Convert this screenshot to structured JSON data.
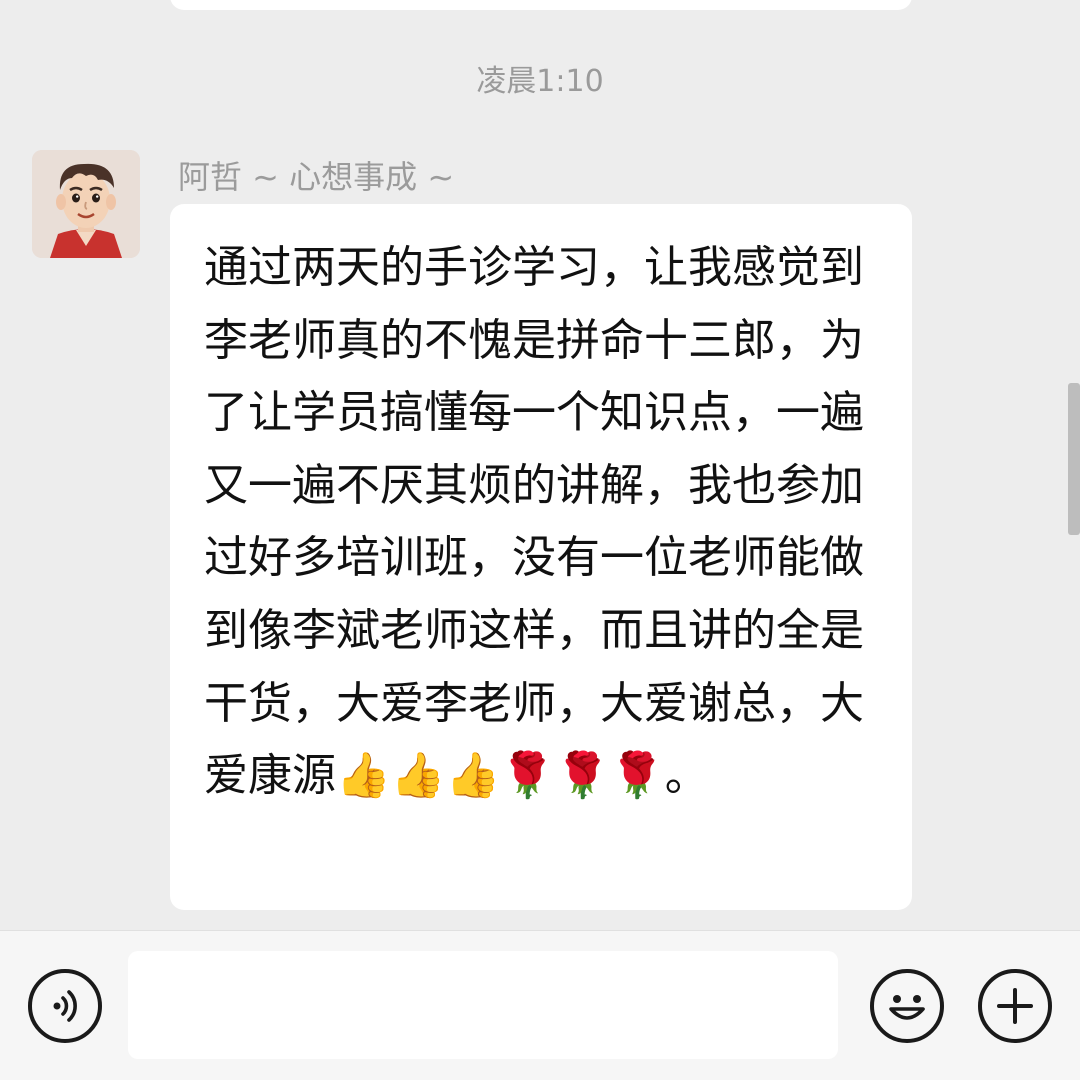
{
  "chat": {
    "timestamp": "凌晨1:10",
    "message": {
      "sender": "阿哲 ~ 心想事成 ~",
      "text": "通过两天的手诊学习，让我感觉到李老师真的不愧是拼命十三郎，为了让学员搞懂每一个知识点，一遍又一遍不厌其烦的讲解，我也参加过好多培训班，没有一位老师能做到像李斌老师这样，而且讲的全是干货，大爱李老师，大爱谢总，大爱康源👍👍👍🌹🌹🌹。"
    }
  },
  "input_bar": {
    "message_value": "",
    "icons": {
      "voice": "voice-icon",
      "emoji": "emoji-smile-icon",
      "add": "plus-icon"
    }
  },
  "colors": {
    "background": "#ededed",
    "bubble": "#ffffff",
    "timestamp": "#9a9a9a",
    "sender": "#9b9b9b",
    "text": "#111111"
  }
}
